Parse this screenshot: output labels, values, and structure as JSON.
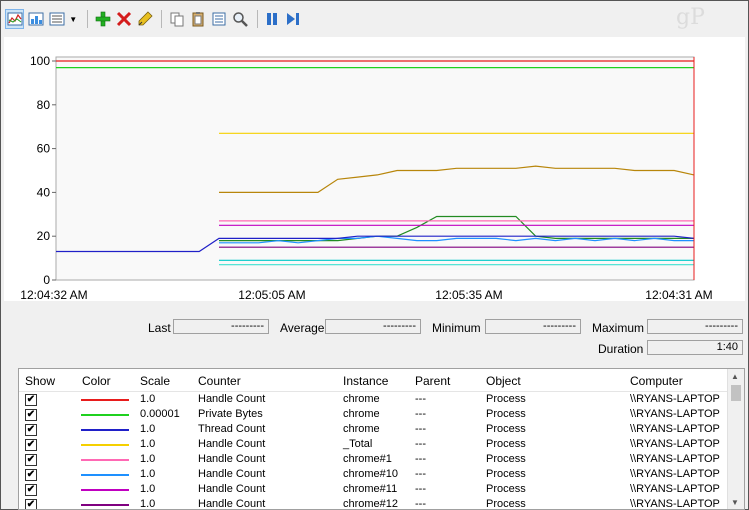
{
  "toolbar": {
    "icons": [
      "view-graph-icon",
      "view-histogram-icon",
      "change-graph-type-icon",
      "add-counter-icon",
      "delete-counter-icon",
      "highlight-icon",
      "copy-properties-icon",
      "paste-counter-list-icon",
      "properties-icon",
      "zoom-icon",
      "freeze-display-icon",
      "update-data-icon"
    ]
  },
  "watermark": "gP",
  "chart_data": {
    "type": "line",
    "ylim": [
      0,
      100
    ],
    "y_ticks": [
      "100",
      "80",
      "60",
      "40",
      "20",
      "0"
    ],
    "x_ticks": [
      "12:04:32 AM",
      "12:05:05 AM",
      "12:05:35 AM",
      "12:04:31 AM"
    ],
    "series": [
      {
        "color": "#e81c1c",
        "values": [
          100,
          100,
          100,
          100,
          100,
          100,
          100,
          100,
          100,
          100,
          100,
          100,
          100,
          100,
          100,
          100,
          100,
          100,
          100,
          100,
          100,
          100,
          100,
          100,
          100,
          100,
          100,
          100,
          100,
          100
        ]
      },
      {
        "color": "#1fd11f",
        "values": [
          97,
          97,
          97,
          97,
          97,
          97,
          97,
          97,
          97,
          97,
          97,
          97,
          97,
          97,
          97,
          97,
          97,
          97,
          97,
          97,
          97,
          97,
          97,
          97,
          97,
          97,
          97,
          97,
          97,
          97
        ]
      },
      {
        "color": "#f5d000",
        "values": [
          null,
          null,
          null,
          null,
          null,
          67,
          67,
          67,
          67,
          67,
          67,
          67,
          67,
          67,
          67,
          67,
          67,
          67,
          67,
          67,
          67,
          67,
          67,
          67,
          67,
          67,
          67,
          67,
          67,
          67
        ]
      },
      {
        "color": "#b8860b",
        "values": [
          null,
          null,
          null,
          null,
          null,
          40,
          40,
          40,
          40,
          40,
          40,
          46,
          47,
          48,
          50,
          50,
          50,
          51,
          51,
          51,
          51,
          52,
          51,
          51,
          51,
          51,
          50,
          50,
          50,
          48
        ]
      },
      {
        "color": "#228b22",
        "values": [
          null,
          null,
          null,
          null,
          null,
          18,
          18,
          18,
          18,
          18,
          18,
          18,
          19,
          20,
          20,
          24,
          29,
          29,
          29,
          29,
          29,
          20,
          19,
          19,
          19,
          19,
          19,
          19,
          19,
          19
        ]
      },
      {
        "color": "#ff69b4",
        "values": [
          null,
          null,
          null,
          null,
          null,
          27,
          27,
          27,
          27,
          27,
          27,
          27,
          27,
          27,
          27,
          27,
          27,
          27,
          27,
          27,
          27,
          27,
          27,
          27,
          27,
          27,
          27,
          27,
          27,
          27
        ]
      },
      {
        "color": "#c000c0",
        "values": [
          null,
          null,
          null,
          null,
          null,
          25,
          25,
          25,
          25,
          25,
          25,
          25,
          25,
          25,
          25,
          25,
          25,
          25,
          25,
          25,
          25,
          25,
          25,
          25,
          25,
          25,
          25,
          25,
          25,
          25
        ]
      },
      {
        "color": "#1e90ff",
        "values": [
          null,
          null,
          null,
          null,
          null,
          17,
          17,
          17,
          18,
          17,
          18,
          19,
          19,
          20,
          19,
          18,
          18,
          19,
          19,
          19,
          18,
          19,
          18,
          19,
          18,
          19,
          18,
          19,
          18,
          18
        ]
      },
      {
        "color": "#2020c8",
        "values": [
          13,
          13,
          13,
          13,
          13,
          19,
          19,
          19,
          19,
          19,
          19,
          19,
          20,
          20,
          20,
          20,
          20,
          20,
          20,
          20,
          20,
          20,
          20,
          20,
          20,
          20,
          20,
          20,
          20,
          19
        ]
      },
      {
        "color": "#00c8c8",
        "values": [
          null,
          null,
          null,
          null,
          null,
          9,
          9,
          9,
          9,
          9,
          9,
          9,
          9,
          9,
          9,
          9,
          9,
          9,
          9,
          9,
          9,
          9,
          9,
          9,
          9,
          9,
          9,
          9,
          9,
          9
        ]
      },
      {
        "color": "#40e0d0",
        "values": [
          null,
          null,
          null,
          null,
          null,
          7,
          7,
          7,
          7,
          7,
          7,
          7,
          7,
          7,
          7,
          7,
          7,
          7,
          7,
          7,
          7,
          7,
          7,
          7,
          7,
          7,
          7,
          7,
          7,
          7
        ]
      },
      {
        "color": "#800080",
        "values": [
          null,
          null,
          null,
          null,
          null,
          15,
          15,
          15,
          15,
          15,
          15,
          15,
          15,
          15,
          15,
          15,
          15,
          15,
          15,
          15,
          15,
          15,
          15,
          15,
          15,
          15,
          15,
          15,
          15,
          15
        ]
      }
    ]
  },
  "stats": {
    "last_label": "Last",
    "last_value": "---------",
    "average_label": "Average",
    "average_value": "---------",
    "minimum_label": "Minimum",
    "minimum_value": "---------",
    "maximum_label": "Maximum",
    "maximum_value": "---------",
    "duration_label": "Duration",
    "duration_value": "1:40"
  },
  "legend": {
    "headers": {
      "show": "Show",
      "color": "Color",
      "scale": "Scale",
      "counter": "Counter",
      "instance": "Instance",
      "parent": "Parent",
      "object": "Object",
      "computer": "Computer"
    },
    "rows": [
      {
        "show": "✔",
        "color": "#e81c1c",
        "scale": "1.0",
        "counter": "Handle Count",
        "instance": "chrome",
        "parent": "---",
        "object": "Process",
        "computer": "\\\\RYANS-LAPTOP"
      },
      {
        "show": "✔",
        "color": "#1fd11f",
        "scale": "0.00001",
        "counter": "Private Bytes",
        "instance": "chrome",
        "parent": "---",
        "object": "Process",
        "computer": "\\\\RYANS-LAPTOP"
      },
      {
        "show": "✔",
        "color": "#2020c8",
        "scale": "1.0",
        "counter": "Thread Count",
        "instance": "chrome",
        "parent": "---",
        "object": "Process",
        "computer": "\\\\RYANS-LAPTOP"
      },
      {
        "show": "✔",
        "color": "#f5d000",
        "scale": "1.0",
        "counter": "Handle Count",
        "instance": "_Total",
        "parent": "---",
        "object": "Process",
        "computer": "\\\\RYANS-LAPTOP"
      },
      {
        "show": "✔",
        "color": "#ff69b4",
        "scale": "1.0",
        "counter": "Handle Count",
        "instance": "chrome#1",
        "parent": "---",
        "object": "Process",
        "computer": "\\\\RYANS-LAPTOP"
      },
      {
        "show": "✔",
        "color": "#1e90ff",
        "scale": "1.0",
        "counter": "Handle Count",
        "instance": "chrome#10",
        "parent": "---",
        "object": "Process",
        "computer": "\\\\RYANS-LAPTOP"
      },
      {
        "show": "✔",
        "color": "#c000c0",
        "scale": "1.0",
        "counter": "Handle Count",
        "instance": "chrome#11",
        "parent": "---",
        "object": "Process",
        "computer": "\\\\RYANS-LAPTOP"
      },
      {
        "show": "✔",
        "color": "#800080",
        "scale": "1.0",
        "counter": "Handle Count",
        "instance": "chrome#12",
        "parent": "---",
        "object": "Process",
        "computer": "\\\\RYANS-LAPTOP"
      }
    ]
  }
}
